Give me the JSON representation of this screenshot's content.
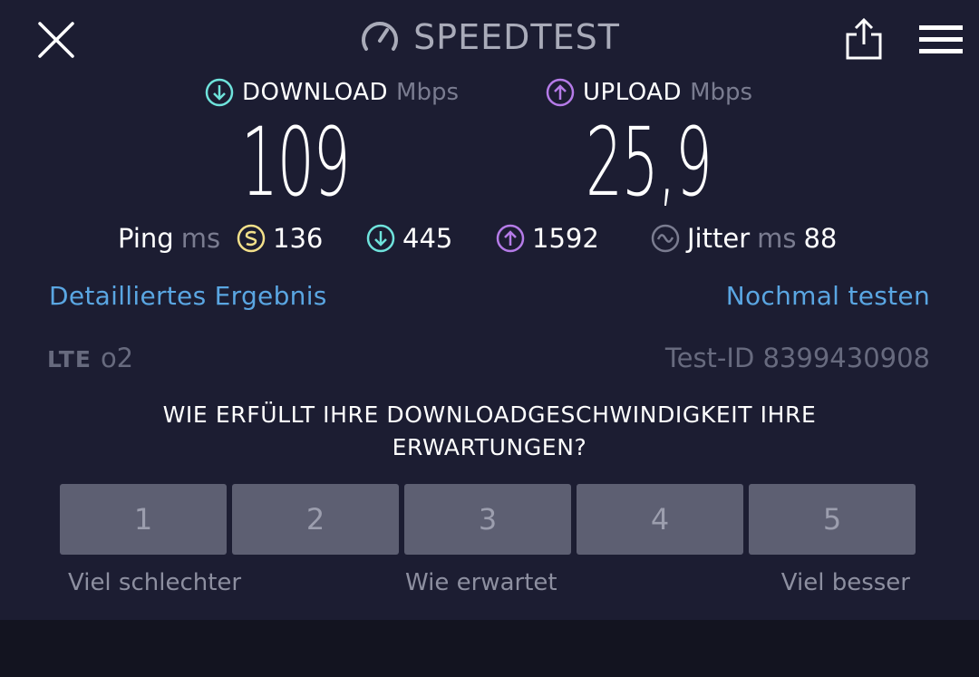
{
  "header": {
    "brand": "SPEEDTEST",
    "icons": [
      "close-icon",
      "speedometer-icon",
      "share-icon",
      "menu-icon"
    ]
  },
  "download": {
    "label": "DOWNLOAD",
    "unit": "Mbps",
    "value": "109"
  },
  "upload": {
    "label": "UPLOAD",
    "unit": "Mbps",
    "value": "25,9"
  },
  "ping": {
    "label": "Ping",
    "unit": "ms",
    "idle": "136",
    "download": "445",
    "upload": "1592"
  },
  "jitter": {
    "label": "Jitter",
    "unit": "ms",
    "value": "88"
  },
  "links": {
    "details": "Detailliertes Ergebnis",
    "retest": "Nochmal testen"
  },
  "connection": {
    "tech": "LTE",
    "carrier": "o2",
    "test_id": "Test-ID 8399430908"
  },
  "survey": {
    "question": "WIE ERFÜLLT IHRE DOWNLOADGESCHWINDIGKEIT IHRE ERWARTUNGEN?",
    "options": [
      "1",
      "2",
      "3",
      "4",
      "5"
    ],
    "scale_low": "Viel schlechter",
    "scale_mid": "Wie erwartet",
    "scale_high": "Viel besser"
  },
  "colors": {
    "background": "#1c1d32",
    "link": "#5aa6e2",
    "download_accent": "#6fe3dc",
    "upload_accent": "#b57be8",
    "ping_accent": "#f3e08a",
    "rating_button": "#5d5f72"
  }
}
